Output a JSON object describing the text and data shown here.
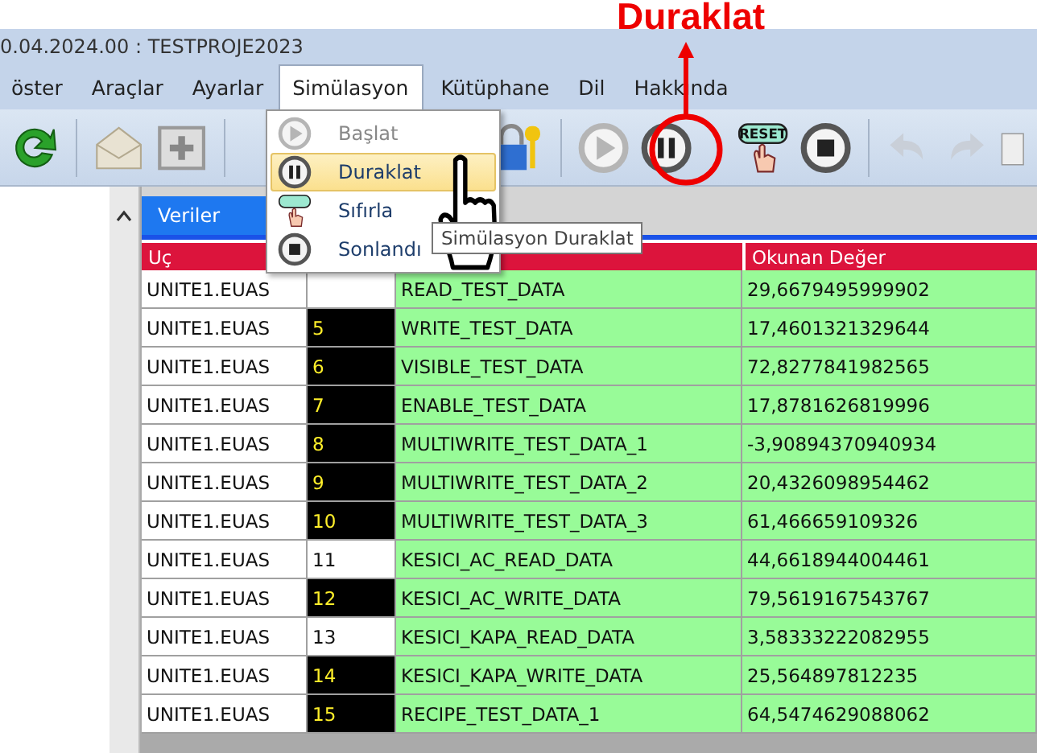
{
  "annotation": {
    "label": "Duraklat"
  },
  "window": {
    "title": "0.04.2024.00 : TESTPROJE2023"
  },
  "menu": [
    {
      "label": "öster",
      "selected": false
    },
    {
      "label": "Araçlar",
      "selected": false
    },
    {
      "label": "Ayarlar",
      "selected": false
    },
    {
      "label": "Simülasyon",
      "selected": true
    },
    {
      "label": "Kütüphane",
      "selected": false
    },
    {
      "label": "Dil",
      "selected": false
    },
    {
      "label": "Hakkında",
      "selected": false
    }
  ],
  "dropdown": [
    {
      "label": "Başlat",
      "kind": "play",
      "disabled": true,
      "selected": false
    },
    {
      "label": "Duraklat",
      "kind": "pause",
      "disabled": false,
      "selected": true
    },
    {
      "label": "Sıfırla",
      "kind": "reset",
      "disabled": false,
      "selected": false
    },
    {
      "label": "Sonlandı",
      "kind": "stop",
      "disabled": false,
      "selected": false
    }
  ],
  "toolbar": {
    "reset_label": "RESET"
  },
  "tooltip": "Simülasyon Duraklat",
  "tabs": [
    {
      "label": "Veriler",
      "selected": true
    }
  ],
  "table": {
    "header": {
      "column_1": "Uç",
      "column_4": "Okunan Değer"
    },
    "rows": [
      {
        "source": "UNITE1.EUAS",
        "active": false,
        "name": "READ_TEST_DATA",
        "value": "29,6679495999902"
      },
      {
        "source": "UNITE1.EUAS",
        "index": "5",
        "active": true,
        "name": "WRITE_TEST_DATA",
        "value": "17,4601321329644"
      },
      {
        "source": "UNITE1.EUAS",
        "index": "6",
        "active": true,
        "name": "VISIBLE_TEST_DATA",
        "value": "72,8277841982565"
      },
      {
        "source": "UNITE1.EUAS",
        "index": "7",
        "active": true,
        "name": "ENABLE_TEST_DATA",
        "value": "17,8781626819996"
      },
      {
        "source": "UNITE1.EUAS",
        "index": "8",
        "active": true,
        "name": "MULTIWRITE_TEST_DATA_1",
        "value": "-3,90894370940934"
      },
      {
        "source": "UNITE1.EUAS",
        "index": "9",
        "active": true,
        "name": "MULTIWRITE_TEST_DATA_2",
        "value": "20,4326098954462"
      },
      {
        "source": "UNITE1.EUAS",
        "index": "10",
        "active": true,
        "name": "MULTIWRITE_TEST_DATA_3",
        "value": "61,466659109326"
      },
      {
        "source": "UNITE1.EUAS",
        "index": "11",
        "active": false,
        "name": "KESICI_AC_READ_DATA",
        "value": "44,6618944004461"
      },
      {
        "source": "UNITE1.EUAS",
        "index": "12",
        "active": true,
        "name": "KESICI_AC_WRITE_DATA",
        "value": "79,5619167543767"
      },
      {
        "source": "UNITE1.EUAS",
        "index": "13",
        "active": false,
        "name": "KESICI_KAPA_READ_DATA",
        "value": "3,58333222082955"
      },
      {
        "source": "UNITE1.EUAS",
        "index": "14",
        "active": true,
        "name": "KESICI_KAPA_WRITE_DATA",
        "value": "25,564897812235"
      },
      {
        "source": "UNITE1.EUAS",
        "index": "15",
        "active": true,
        "name": "RECIPE_TEST_DATA_1",
        "value": "64,5474629088062"
      }
    ]
  }
}
